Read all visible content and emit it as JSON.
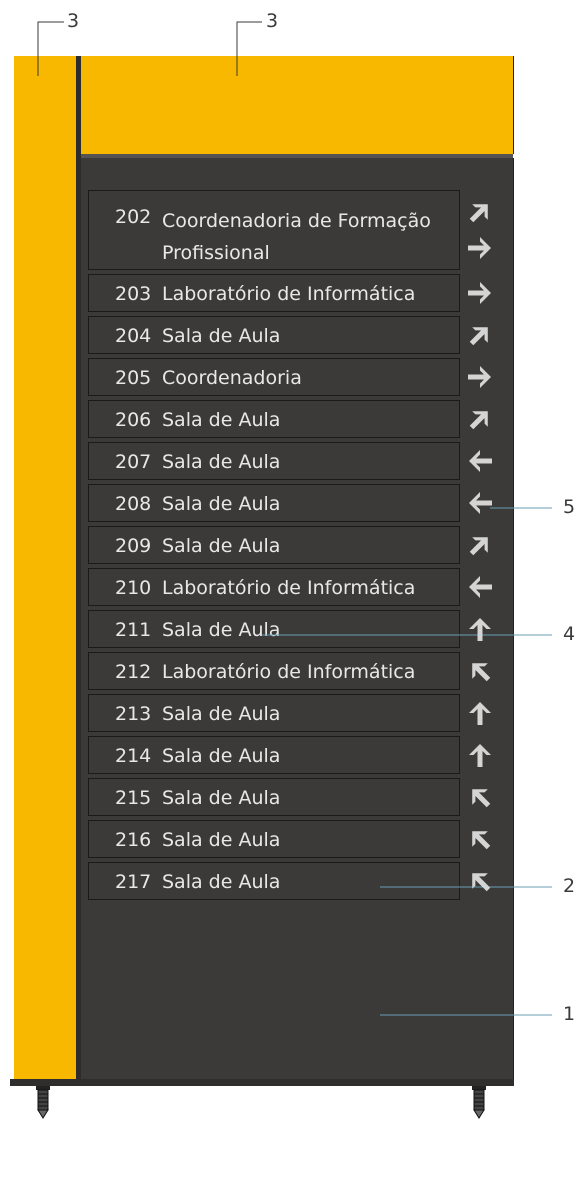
{
  "callouts": {
    "top_left": "3",
    "top_middle": "3",
    "right_5": "5",
    "right_4": "4",
    "right_2": "2",
    "right_1": "1"
  },
  "rooms": [
    {
      "number": "202",
      "label": "Coordenadoria de Formação Profissional",
      "arrow": "up-right"
    },
    {
      "number": "203",
      "label": "Laboratório de Informática",
      "arrow": "right"
    },
    {
      "number": "204",
      "label": "Sala de Aula",
      "arrow": "up-right"
    },
    {
      "number": "205",
      "label": "Coordenadoria",
      "arrow": "right"
    },
    {
      "number": "206",
      "label": "Sala de Aula",
      "arrow": "up-right"
    },
    {
      "number": "207",
      "label": "Sala de Aula",
      "arrow": "left"
    },
    {
      "number": "208",
      "label": "Sala de Aula",
      "arrow": "left"
    },
    {
      "number": "209",
      "label": "Sala de Aula",
      "arrow": "up-right"
    },
    {
      "number": "210",
      "label": "Laboratório de Informática",
      "arrow": "left"
    },
    {
      "number": "211",
      "label": "Sala de Aula",
      "arrow": "up"
    },
    {
      "number": "212",
      "label": "Laboratório de Informática",
      "arrow": "up-left"
    },
    {
      "number": "213",
      "label": "Sala de Aula",
      "arrow": "up"
    },
    {
      "number": "214",
      "label": "Sala de Aula",
      "arrow": "up"
    },
    {
      "number": "215",
      "label": "Sala de Aula",
      "arrow": "up-left"
    },
    {
      "number": "216",
      "label": "Sala de Aula",
      "arrow": "up-left"
    },
    {
      "number": "217",
      "label": "Sala de Aula",
      "arrow": "up-left"
    }
  ],
  "colors": {
    "panel": "#3b3a39",
    "accent": "#f9b800",
    "arrow": "#d4d4d4"
  }
}
